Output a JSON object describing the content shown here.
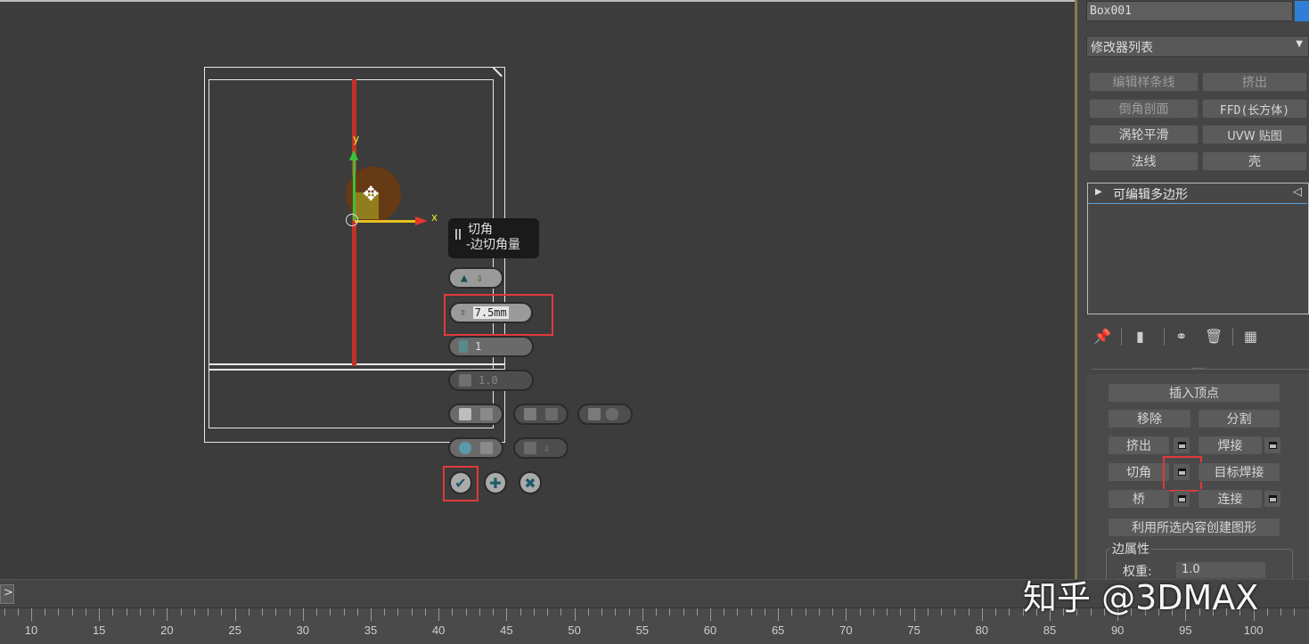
{
  "viewport": {
    "axis_x_label": "x",
    "axis_y_label": "y",
    "tooltip": {
      "title": "切角",
      "subtitle": "-边切角量"
    },
    "caddy": {
      "amount_value": "7.5mm",
      "segments_value": "1",
      "tension_value": "1.0"
    }
  },
  "panel": {
    "object_name": "Box001",
    "modifier_list": "修改器列表",
    "modifier_buttons": [
      "编辑样条线",
      "挤出",
      "倒角剖面",
      "FFD(长方体)",
      "涡轮平滑",
      "UVW 贴图",
      "法线",
      "壳"
    ],
    "stack_item": "可编辑多边形",
    "edit_edges": {
      "insert_vertex": "插入顶点",
      "remove": "移除",
      "split": "分割",
      "extrude": "挤出",
      "weld": "焊接",
      "chamfer": "切角",
      "target_weld": "目标焊接",
      "bridge": "桥",
      "connect": "连接",
      "create_shape": "利用所选内容创建图形"
    },
    "edge_properties": {
      "title": "边属性",
      "weight_label": "权重:",
      "weight_value": "1.0"
    }
  },
  "timeline": {
    "expand_glyph": ">",
    "ruler_labels": [
      "10",
      "15",
      "20",
      "25",
      "30",
      "35",
      "40",
      "45",
      "50",
      "55",
      "60",
      "65",
      "70",
      "75",
      "80",
      "85",
      "90",
      "95",
      "100"
    ]
  },
  "watermark": "知乎 @3DMAX",
  "colors": {
    "highlight_red": "#e03a3a",
    "axis_x": "#e23a2a",
    "axis_y": "#3ac23a",
    "accent_blue": "#2f7fd6"
  },
  "icons": [
    "move-gizmo-icon",
    "pin-icon",
    "show-end-result-icon",
    "make-unique-icon",
    "remove-modifier-icon",
    "configure-sets-icon",
    "checkmark-icon",
    "plus-icon",
    "cancel-icon"
  ]
}
